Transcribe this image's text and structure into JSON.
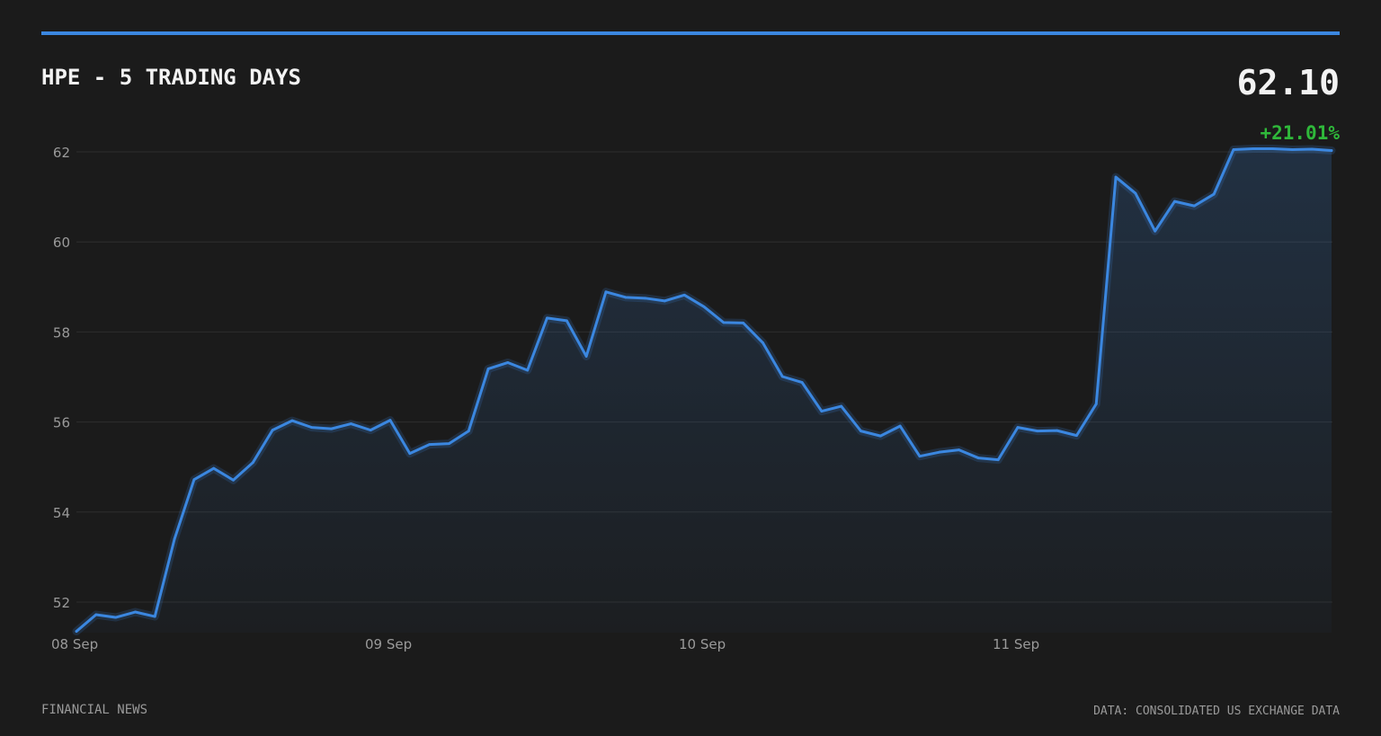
{
  "header": {
    "title": "HPE - 5 TRADING DAYS",
    "price": "62.10",
    "change": "+21.01%"
  },
  "footer": {
    "source_left": "FINANCIAL NEWS",
    "source_right": "DATA: CONSOLIDATED US EXCHANGE DATA"
  },
  "colors": {
    "background": "#1b1b1b",
    "accent": "#3b87e0",
    "positive": "#2fb83a",
    "gridline": "#2e2e2e",
    "text_muted": "#9a9a9a"
  },
  "chart_data": {
    "type": "area",
    "x_tick_labels": [
      "08 Sep",
      "09 Sep",
      "10 Sep",
      "11 Sep"
    ],
    "x_tick_index": [
      0,
      16,
      32,
      48
    ],
    "y_ticks": [
      52,
      54,
      56,
      58,
      60,
      62
    ],
    "ylim": [
      51.6,
      62.4
    ],
    "grid": true,
    "series": [
      {
        "values": [
          51.35,
          51.72,
          51.66,
          51.78,
          51.68,
          53.4,
          54.72,
          54.97,
          54.71,
          55.1,
          55.82,
          56.03,
          55.88,
          55.85,
          55.96,
          55.82,
          56.04,
          55.3,
          55.5,
          55.52,
          55.8,
          57.18,
          57.32,
          57.15,
          58.31,
          58.25,
          57.46,
          58.89,
          58.77,
          58.75,
          58.69,
          58.82,
          58.56,
          58.21,
          58.2,
          57.76,
          57.01,
          56.88,
          56.24,
          56.35,
          55.8,
          55.69,
          55.91,
          55.24,
          55.33,
          55.38,
          55.2,
          55.16,
          55.88,
          55.8,
          55.81,
          55.7,
          56.4,
          61.44,
          61.08,
          60.24,
          60.9,
          60.8,
          61.06,
          62.05,
          62.07,
          62.07,
          62.05,
          62.06,
          62.03
        ]
      }
    ]
  }
}
